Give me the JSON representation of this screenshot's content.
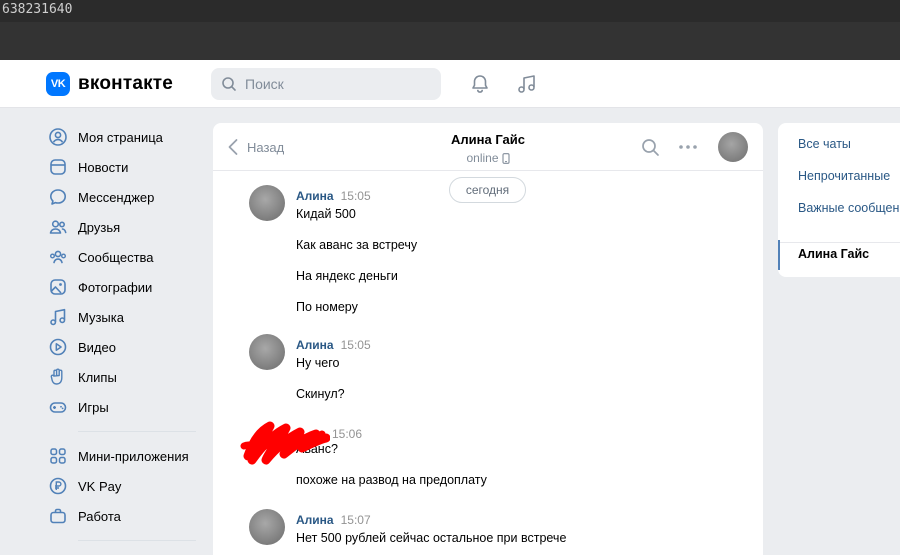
{
  "window": {
    "top_code": "638231640"
  },
  "header": {
    "logo_mark": "VK",
    "logo_text": "вконтакте",
    "search_placeholder": "Поиск",
    "icons": [
      "bell-icon",
      "music-icon"
    ]
  },
  "sidebar": {
    "items": [
      {
        "label": "Моя страница",
        "icon": "profile-icon"
      },
      {
        "label": "Новости",
        "icon": "news-icon"
      },
      {
        "label": "Мессенджер",
        "icon": "messenger-icon"
      },
      {
        "label": "Друзья",
        "icon": "friends-icon"
      },
      {
        "label": "Сообщества",
        "icon": "communities-icon"
      },
      {
        "label": "Фотографии",
        "icon": "photos-icon"
      },
      {
        "label": "Музыка",
        "icon": "music-icon"
      },
      {
        "label": "Видео",
        "icon": "video-icon"
      },
      {
        "label": "Клипы",
        "icon": "clips-icon"
      },
      {
        "label": "Игры",
        "icon": "games-icon"
      }
    ],
    "extra_items": [
      {
        "label": "Мини-приложения",
        "icon": "mini-apps-icon"
      },
      {
        "label": "VK Pay",
        "icon": "vkpay-icon"
      },
      {
        "label": "Работа",
        "icon": "work-icon"
      }
    ]
  },
  "chat": {
    "back_label": "Назад",
    "peer_name": "Алина Гайс",
    "peer_status": "online",
    "date_separator": "сегодня",
    "groups": [
      {
        "author": "Алина",
        "time": "15:05",
        "lines": [
          "Кидай 500",
          "Как аванс за встречу",
          "На яндекс деньги",
          "По номеру"
        ]
      },
      {
        "author": "Алина",
        "time": "15:05",
        "lines": [
          "Ну чего",
          "Скинул?"
        ]
      },
      {
        "author": "",
        "time": "15:06",
        "lines": [
          "Аванс?",
          "похоже на развод на предоплату"
        ]
      },
      {
        "author": "Алина",
        "time": "15:07",
        "lines": [
          "Нет 500 рублей сейчас остальное при встрече"
        ]
      }
    ]
  },
  "right_panel": {
    "items": [
      "Все чаты",
      "Непрочитанные",
      "Важные сообщения"
    ],
    "active_chat": "Алина Гайс"
  },
  "colors": {
    "accent": "#0077ff",
    "link": "#2a5885",
    "redaction": "#ff0000"
  }
}
